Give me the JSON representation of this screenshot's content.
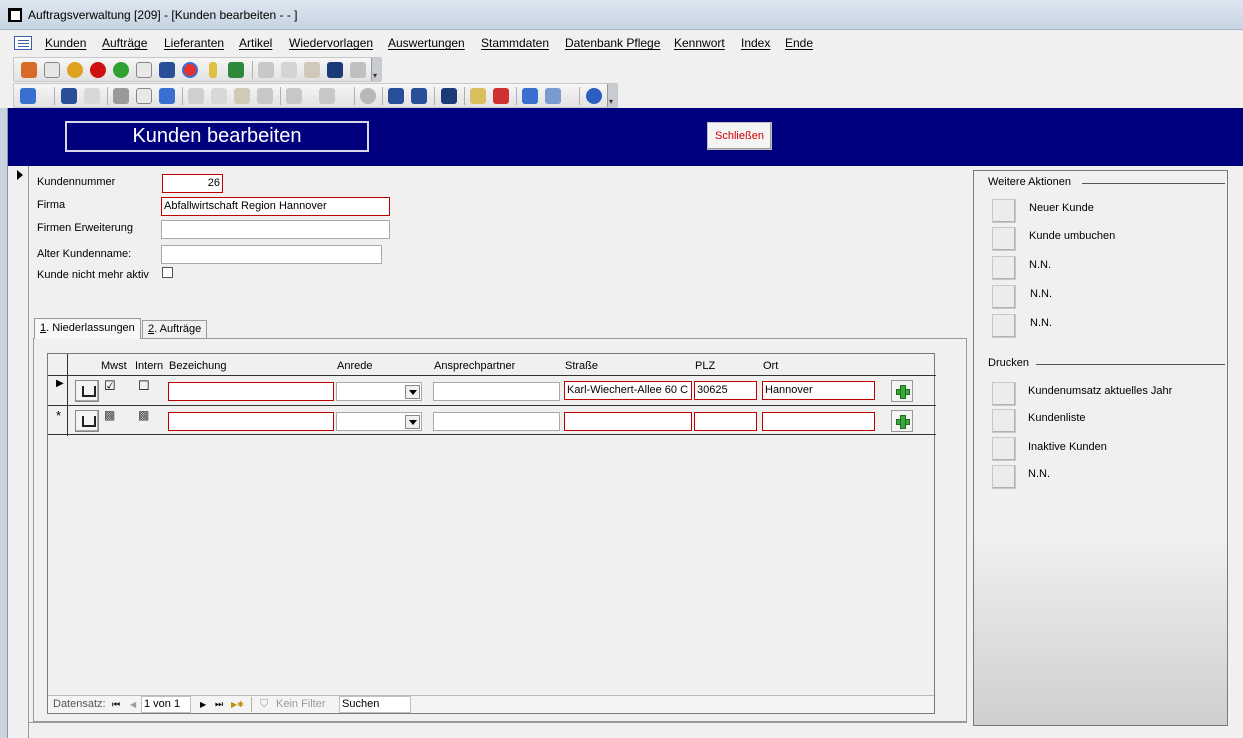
{
  "window": {
    "title": "Auftragsverwaltung [209] - [Kunden bearbeiten -  - ]"
  },
  "menu": {
    "items": [
      "Kunden",
      "Aufträge",
      "Lieferanten",
      "Artikel",
      "Wiedervorlagen",
      "Auswertungen",
      "Stammdaten",
      "Datenbank Pflege",
      "Kennwort",
      "Index",
      "Ende"
    ]
  },
  "header": {
    "title": "Kunden bearbeiten",
    "close_label": "Schließen"
  },
  "form": {
    "kundennummer_label": "Kundennummer",
    "kundennummer_value": "26",
    "firma_label": "Firma",
    "firma_value": "Abfallwirtschaft Region Hannover",
    "firmen_erweiterung_label": "Firmen Erweiterung",
    "firmen_erweiterung_value": "",
    "alter_kundenname_label": "Alter Kundenname:",
    "alter_kundenname_value": "",
    "inaktiv_label": "Kunde nicht mehr aktiv",
    "inaktiv_checked": false
  },
  "tabs": [
    {
      "key": "1",
      "label": ". Niederlassungen",
      "active": true
    },
    {
      "key": "2",
      "label": ". Aufträge",
      "active": false
    }
  ],
  "grid": {
    "columns": [
      "Mwst",
      "Intern",
      "Bezeichung",
      "Anrede",
      "Ansprechpartner",
      "Straße",
      "PLZ",
      "Ort"
    ],
    "rows": [
      {
        "marker": "▶",
        "mwst": "☑",
        "intern": "☐",
        "bezeichung": "",
        "anrede": "",
        "ansprechpartner": "",
        "strasse": "Karl-Wiechert-Allee 60 C",
        "plz": "30625",
        "ort": "Hannover"
      },
      {
        "marker": "*",
        "mwst": "▩",
        "intern": "▩",
        "bezeichung": "",
        "anrede": "",
        "ansprechpartner": "",
        "strasse": "",
        "plz": "",
        "ort": ""
      }
    ]
  },
  "navigation": {
    "label": "Datensatz:",
    "position": "1 von 1",
    "filter": "Kein Filter",
    "search": "Suchen",
    "first": "⏮",
    "prev": "◀",
    "next": "▶",
    "last": "⏭",
    "new": "▶✱"
  },
  "right_panel": {
    "weitere_title": "Weitere Aktionen",
    "weitere_items": [
      "Neuer Kunde",
      "Kunde umbuchen",
      "N.N.",
      "N.N.",
      "N.N."
    ],
    "drucken_title": "Drucken",
    "drucken_items": [
      "Kundenumsatz aktuelles Jahr",
      "Kundenliste",
      "Inaktive Kunden",
      "N.N."
    ]
  },
  "colors": {
    "header_band": "#00007f",
    "required_border": "#c00000",
    "close_text": "#cc0000"
  }
}
